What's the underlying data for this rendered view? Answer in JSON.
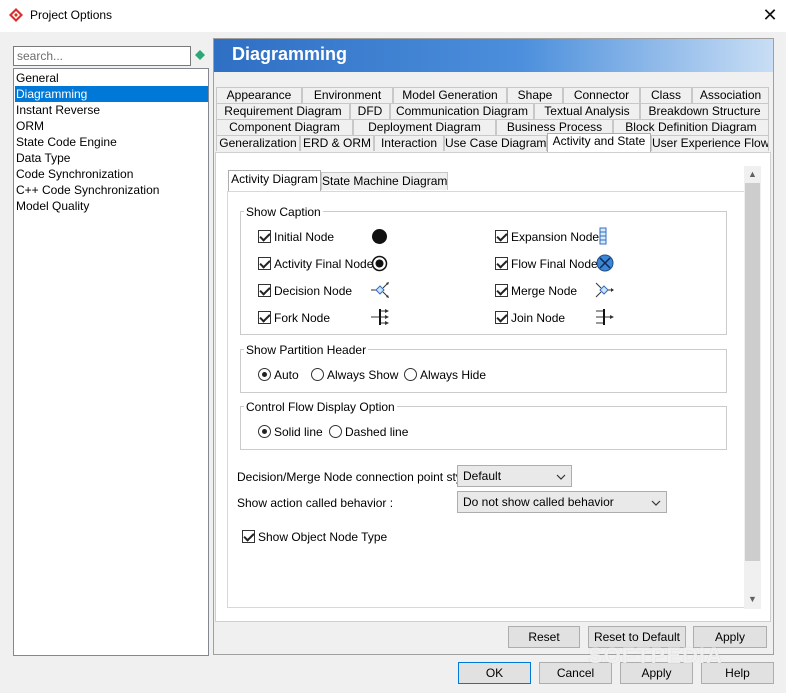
{
  "window": {
    "title": "Project Options",
    "close_glyph": "✕"
  },
  "search": {
    "placeholder": "search..."
  },
  "nav": {
    "items": [
      {
        "label": "General",
        "selected": false
      },
      {
        "label": "Diagramming",
        "selected": true
      },
      {
        "label": "Instant Reverse",
        "selected": false
      },
      {
        "label": "ORM",
        "selected": false
      },
      {
        "label": "State Code Engine",
        "selected": false
      },
      {
        "label": "Data Type",
        "selected": false
      },
      {
        "label": "Code Synchronization",
        "selected": false
      },
      {
        "label": "C++ Code Synchronization",
        "selected": false
      },
      {
        "label": "Model Quality",
        "selected": false
      }
    ]
  },
  "panel": {
    "title": "Diagramming"
  },
  "tabs": {
    "row1": [
      "Appearance",
      "Environment",
      "Model Generation",
      "Shape",
      "Connector",
      "Class",
      "Association"
    ],
    "row2": [
      "Requirement Diagram",
      "DFD",
      "Communication Diagram",
      "Textual Analysis",
      "Breakdown Structure"
    ],
    "row3": [
      "Component Diagram",
      "Deployment Diagram",
      "Business Process",
      "Block Definition Diagram"
    ],
    "row4": [
      "Generalization",
      "ERD & ORM",
      "Interaction",
      "Use Case Diagram",
      "Activity and State",
      "User Experience Flow"
    ],
    "active": "Activity and State"
  },
  "subtabs": {
    "items": [
      "Activity Diagram",
      "State Machine Diagram"
    ],
    "active": "Activity Diagram"
  },
  "show_caption": {
    "legend": "Show Caption",
    "items": [
      {
        "label": "Initial Node",
        "checked": true,
        "icon": "initial-node-icon"
      },
      {
        "label": "Expansion Node",
        "checked": true,
        "icon": "expansion-node-icon"
      },
      {
        "label": "Activity Final Node",
        "checked": true,
        "icon": "activity-final-node-icon"
      },
      {
        "label": "Flow Final Node",
        "checked": true,
        "icon": "flow-final-node-icon"
      },
      {
        "label": "Decision Node",
        "checked": true,
        "icon": "decision-node-icon"
      },
      {
        "label": "Merge Node",
        "checked": true,
        "icon": "merge-node-icon"
      },
      {
        "label": "Fork Node",
        "checked": true,
        "icon": "fork-node-icon"
      },
      {
        "label": "Join Node",
        "checked": true,
        "icon": "join-node-icon"
      }
    ]
  },
  "partition_header": {
    "legend": "Show Partition Header",
    "options": [
      "Auto",
      "Always Show",
      "Always Hide"
    ],
    "selected": "Auto"
  },
  "control_flow": {
    "legend": "Control Flow Display Option",
    "options": [
      "Solid line",
      "Dashed line"
    ],
    "selected": "Solid line"
  },
  "connection_style": {
    "label": "Decision/Merge Node connection point style :",
    "value": "Default"
  },
  "called_behavior": {
    "label": "Show action called behavior :",
    "value": "Do not show called behavior"
  },
  "object_node_type": {
    "label": "Show Object Node Type",
    "checked": true
  },
  "panel_buttons": {
    "reset": "Reset",
    "reset_default": "Reset to Default",
    "apply": "Apply"
  },
  "dialog_buttons": {
    "ok": "OK",
    "cancel": "Cancel",
    "apply": "Apply",
    "help": "Help"
  },
  "watermark": "SOFTPEDIA",
  "colors": {
    "accent": "#0078d7",
    "banner_start": "#2f6fc4",
    "banner_end": "#c9def5",
    "flow_final_fill": "#3d85d6"
  }
}
